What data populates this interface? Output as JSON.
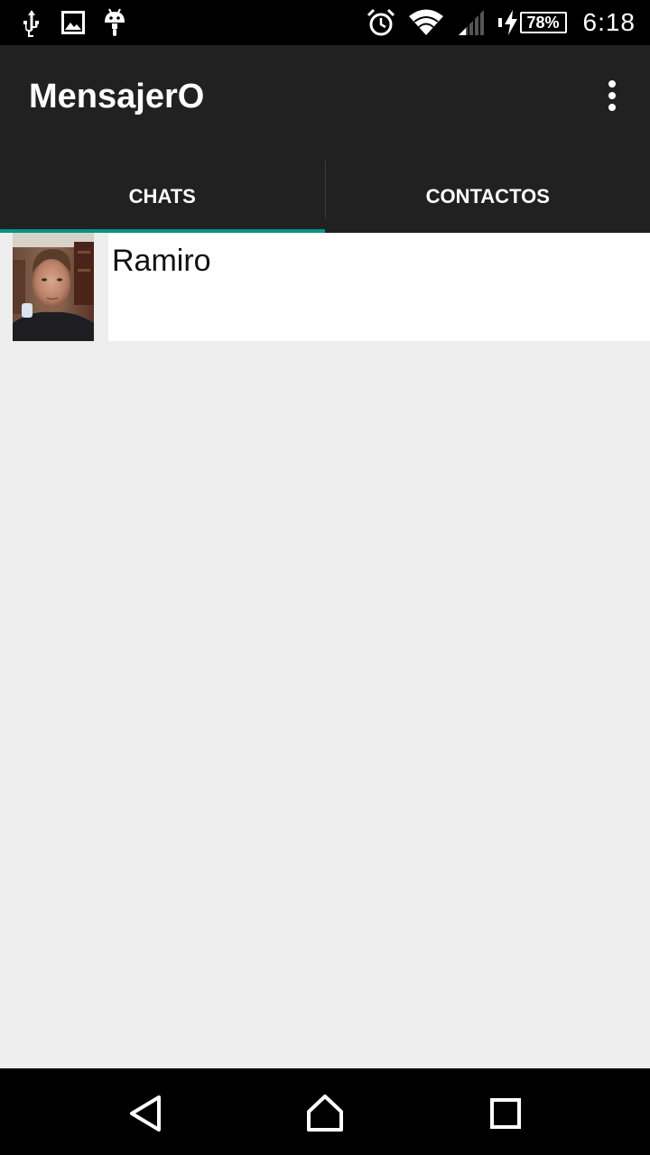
{
  "status_bar": {
    "left_icons": [
      "usb-icon",
      "image-icon",
      "android-icon"
    ],
    "right_icons": [
      "alarm-icon",
      "wifi-icon",
      "signal-icon",
      "charging-icon"
    ],
    "battery_label": "78%",
    "battery_level": 0.78,
    "time": "6:18"
  },
  "app_bar": {
    "title": "MensajerO",
    "menu_icon": "more-vert-icon"
  },
  "tabs": [
    {
      "label": "CHATS",
      "selected": true
    },
    {
      "label": "CONTACTOS",
      "selected": false
    }
  ],
  "chats": [
    {
      "name": "Ramiro",
      "avatar": "avatar-photo"
    }
  ],
  "nav_bar": {
    "icons": [
      "back-icon",
      "home-icon",
      "recents-icon"
    ]
  },
  "colors": {
    "app_bar_bg": "#212121",
    "tab_indicator": "#009688",
    "content_bg": "#eeeeee",
    "status_bar_bg": "#000000"
  }
}
